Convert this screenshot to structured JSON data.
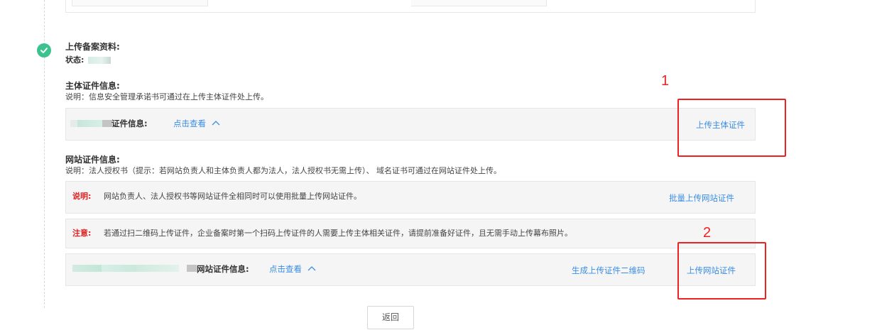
{
  "upload_section": {
    "title": "上传备案资料:",
    "status_label": "状态:"
  },
  "subject_cert": {
    "heading": "主体证件信息:",
    "description": "说明：信息安全管理承诺书可通过在上传主体证件处上传。",
    "row_label": "证件信息:",
    "view_link": "点击查看",
    "upload_button": "上传主体证件"
  },
  "website_cert": {
    "heading": "网站证件信息:",
    "description": "说明：法人授权书（提示：若网站负责人和主体负责人都为法人，法人授权书无需上传）、 域名证书可通过在网站证件处上传。",
    "note1_label": "说明:",
    "note1_text": "网站负责人、法人授权书等网站证件全相同时可以使用批量上传网站证件。",
    "batch_upload_link": "批量上传网站证件",
    "note2_label": "注意:",
    "note2_text": "若通过扫二维码上传证件，企业备案时第一个扫码上传证件的人需要上传主体相关证件，请提前准备好证件，且无需手动上传幕布照片。",
    "row_label": "网站证件信息:",
    "view_link": "点击查看",
    "qr_link": "生成上传证件二维码",
    "upload_button": "上传网站证件"
  },
  "annotations": {
    "box1_number": "1",
    "box2_number": "2"
  },
  "footer": {
    "back_button": "返回"
  },
  "colors": {
    "accent_link": "#3a8ee6",
    "success_green": "#3cc28f",
    "annotation_red": "#ee2222",
    "panel_bg": "#f5f5f5"
  },
  "icons": {
    "step_status": "check-circle-icon",
    "expand": "chevron-up-icon"
  }
}
